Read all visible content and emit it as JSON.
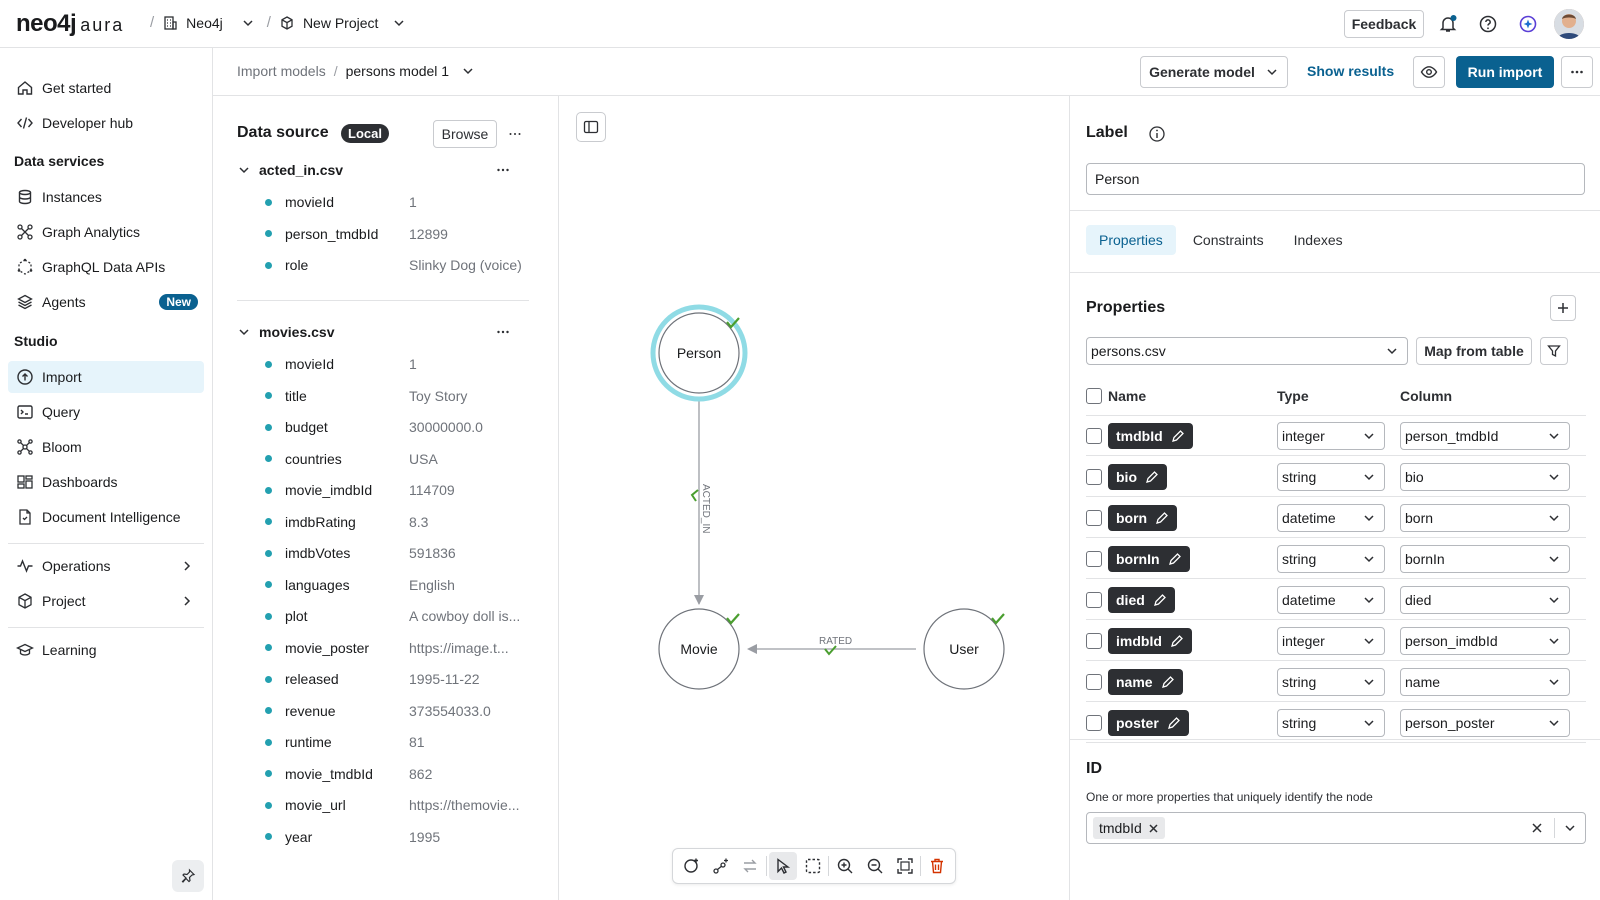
{
  "app": {
    "logo_main": "neo4j",
    "logo_sub": "aura",
    "org": "Neo4j",
    "project": "New Project"
  },
  "header": {
    "feedback": "Feedback"
  },
  "sidebar": {
    "get_started": "Get started",
    "developer_hub": "Developer hub",
    "data_services": "Data services",
    "instances": "Instances",
    "graph_analytics": "Graph Analytics",
    "graphql": "GraphQL Data APIs",
    "agents": "Agents",
    "agents_badge": "New",
    "studio": "Studio",
    "import": "Import",
    "query": "Query",
    "bloom": "Bloom",
    "dashboards": "Dashboards",
    "doc_intel": "Document Intelligence",
    "operations": "Operations",
    "project": "Project",
    "learning": "Learning"
  },
  "breadcrumb": {
    "root": "Import models",
    "current": "persons model 1"
  },
  "actions": {
    "generate": "Generate model",
    "show_results": "Show results",
    "run_import": "Run import"
  },
  "datasource": {
    "title": "Data source",
    "badge": "Local",
    "browse": "Browse",
    "files": [
      {
        "name": "acted_in.csv",
        "fields": [
          {
            "n": "movieId",
            "v": "1"
          },
          {
            "n": "person_tmdbId",
            "v": "12899"
          },
          {
            "n": "role",
            "v": "Slinky Dog (voice)"
          }
        ]
      },
      {
        "name": "movies.csv",
        "fields": [
          {
            "n": "movieId",
            "v": "1"
          },
          {
            "n": "title",
            "v": "Toy Story"
          },
          {
            "n": "budget",
            "v": "30000000.0"
          },
          {
            "n": "countries",
            "v": "USA"
          },
          {
            "n": "movie_imdbId",
            "v": "114709"
          },
          {
            "n": "imdbRating",
            "v": "8.3"
          },
          {
            "n": "imdbVotes",
            "v": "591836"
          },
          {
            "n": "languages",
            "v": "English"
          },
          {
            "n": "plot",
            "v": "A cowboy doll is..."
          },
          {
            "n": "movie_poster",
            "v": "https://image.t..."
          },
          {
            "n": "released",
            "v": "1995-11-22"
          },
          {
            "n": "revenue",
            "v": "373554033.0"
          },
          {
            "n": "runtime",
            "v": "81"
          },
          {
            "n": "movie_tmdbId",
            "v": "862"
          },
          {
            "n": "movie_url",
            "v": "https://themovie..."
          },
          {
            "n": "year",
            "v": "1995"
          }
        ]
      }
    ]
  },
  "graph": {
    "nodes": {
      "person": "Person",
      "movie": "Movie",
      "user": "User"
    },
    "rels": {
      "acted_in": "ACTED_IN",
      "rated": "RATED"
    },
    "colors": {
      "selected_ring": "#8fdbe5",
      "check": "#4a9e2f"
    }
  },
  "panel": {
    "label_title": "Label",
    "label_value": "Person",
    "tabs": [
      "Properties",
      "Constraints",
      "Indexes"
    ],
    "props_title": "Properties",
    "file_select": "persons.csv",
    "map_btn": "Map from table",
    "col_name": "Name",
    "col_type": "Type",
    "col_column": "Column",
    "rows": [
      {
        "name": "tmdbId",
        "type": "integer",
        "column": "person_tmdbId"
      },
      {
        "name": "bio",
        "type": "string",
        "column": "bio"
      },
      {
        "name": "born",
        "type": "datetime",
        "column": "born"
      },
      {
        "name": "bornIn",
        "type": "string",
        "column": "bornIn"
      },
      {
        "name": "died",
        "type": "datetime",
        "column": "died"
      },
      {
        "name": "imdbId",
        "type": "integer",
        "column": "person_imdbId"
      },
      {
        "name": "name",
        "type": "string",
        "column": "name"
      },
      {
        "name": "poster",
        "type": "string",
        "column": "person_poster"
      }
    ],
    "id_title": "ID",
    "id_desc": "One or more properties that uniquely identify the node",
    "id_chip": "tmdbId"
  },
  "colors": {
    "accent": "#0a6190",
    "text": "#1a1b1d",
    "muted": "#6f737a",
    "dot": "#23a0b0",
    "delete": "#d43300"
  }
}
